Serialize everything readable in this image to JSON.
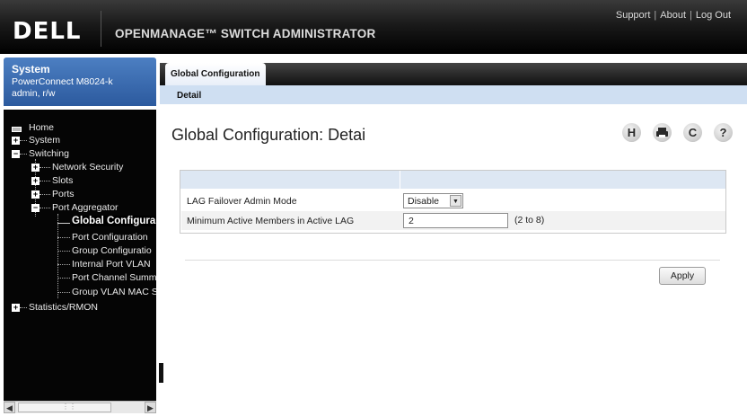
{
  "header": {
    "logo": "DELL",
    "app_title": "OPENMANAGE™ SWITCH ADMINISTRATOR",
    "links": [
      "Support",
      "About",
      "Log Out"
    ],
    "link_separator": "|"
  },
  "system": {
    "title": "System",
    "device": "PowerConnect M8024-k",
    "user": "admin, r/w"
  },
  "nav": {
    "home": "Home",
    "system": "System",
    "switching": "Switching",
    "network_security": "Network Security",
    "slots": "Slots",
    "ports": "Ports",
    "port_aggregator": "Port Aggregator",
    "global_configuration": "Global Configura",
    "port_configuration": "Port Configuration",
    "group_configuration": "Group Configuratio",
    "internal_port_vlan": "Internal Port VLAN",
    "port_channel_summary": "Port Channel Summ",
    "group_vlan_mac": "Group VLAN MAC S",
    "statistics_rmon": "Statistics/RMON"
  },
  "tabs": {
    "active": "Global Configuration",
    "subtab": "Detail"
  },
  "main": {
    "title": "Global Configuration: Detai",
    "icons": [
      "H",
      "print",
      "C",
      "?"
    ],
    "rows": [
      {
        "label": "LAG Failover Admin Mode",
        "value": "Disable"
      },
      {
        "label": "Minimum Active Members in Active LAG",
        "value": "2",
        "hint": "(2 to 8)"
      }
    ],
    "apply_label": "Apply"
  },
  "colors": {
    "header_bg": "#000000",
    "system_box": "#3a6db3",
    "subtab_bg": "#cfdff2",
    "form_header": "#dde7f3"
  }
}
